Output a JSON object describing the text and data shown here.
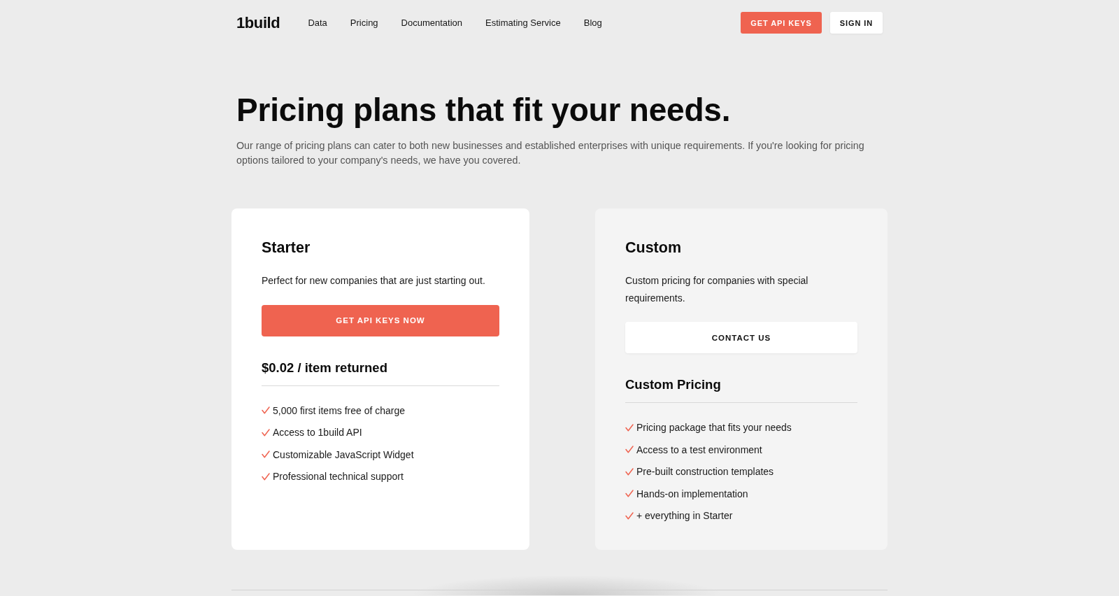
{
  "header": {
    "logo": "1build",
    "nav_links": [
      "Data",
      "Pricing",
      "Documentation",
      "Estimating Service",
      "Blog"
    ],
    "buttons": [
      {
        "label": "GET API KEYS",
        "kind": "primary"
      },
      {
        "label": "SIGN IN",
        "kind": "secondary"
      }
    ]
  },
  "hero": {
    "title": "Pricing plans that fit your needs.",
    "subtitle": "Our range of pricing plans can cater to both new businesses and established enterprises with unique requirements. If you're looking for pricing options tailored to your company's needs, we have you covered."
  },
  "plans": [
    {
      "name": "Starter",
      "highlighted": true,
      "description": "Perfect for new companies that are just starting out.",
      "button": {
        "label": "GET API KEYS NOW",
        "kind": "primary"
      },
      "price": "$0.02 / item returned",
      "features": [
        "5,000 first items free of charge",
        "Access to 1build API",
        "Customizable JavaScript Widget",
        "Professional technical support"
      ]
    },
    {
      "name": "Custom",
      "highlighted": false,
      "description": "Custom pricing for companies with special requirements.",
      "button": {
        "label": "CONTACT US",
        "kind": "secondary"
      },
      "price": "Custom Pricing",
      "features": [
        "Pricing package that fits your needs",
        "Access to a test environment",
        "Pre-built construction templates",
        "Hands-on implementation",
        "+ everything in Starter"
      ]
    }
  ]
}
